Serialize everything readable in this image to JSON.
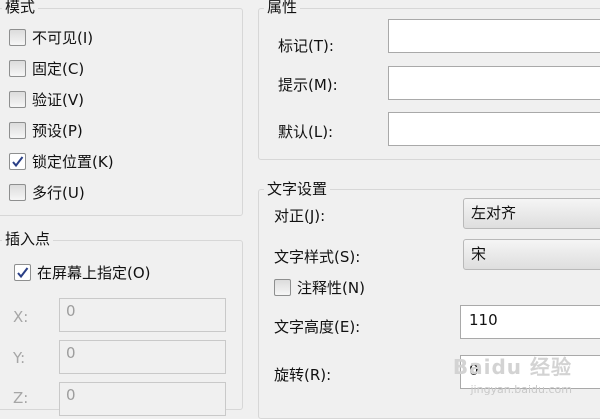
{
  "mode": {
    "title": "模式",
    "options": [
      {
        "label": "不可见(I)",
        "checked": false
      },
      {
        "label": "固定(C)",
        "checked": false
      },
      {
        "label": "验证(V)",
        "checked": false
      },
      {
        "label": "预设(P)",
        "checked": false
      },
      {
        "label": "锁定位置(K)",
        "checked": true
      },
      {
        "label": "多行(U)",
        "checked": false
      }
    ]
  },
  "insert_point": {
    "title": "插入点",
    "specify_on_screen": {
      "label": "在屏幕上指定(O)",
      "checked": true
    },
    "x": {
      "label": "X:",
      "value": "0"
    },
    "y": {
      "label": "Y:",
      "value": "0"
    },
    "z": {
      "label": "Z:",
      "value": "0"
    }
  },
  "attribute": {
    "title": "属性",
    "tag": {
      "label": "标记(T):",
      "value": ""
    },
    "prompt": {
      "label": "提示(M):",
      "value": ""
    },
    "default": {
      "label": "默认(L):",
      "value": ""
    }
  },
  "text_settings": {
    "title": "文字设置",
    "justify": {
      "label": "对正(J):",
      "value": "左对齐"
    },
    "text_style": {
      "label": "文字样式(S):",
      "value": "宋"
    },
    "annotative": {
      "label": "注释性(N)",
      "checked": false
    },
    "text_height": {
      "label": "文字高度(E):",
      "value": "110"
    },
    "rotation": {
      "label": "旋转(R):",
      "value": "0"
    }
  },
  "watermark": {
    "main": "Baidu 经验",
    "sub": "jingyan.baidu.com"
  }
}
